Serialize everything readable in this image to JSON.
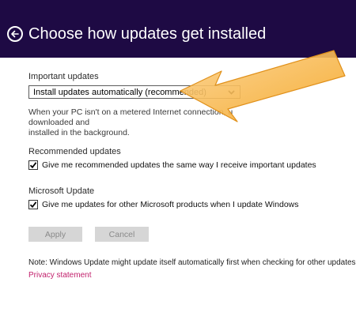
{
  "header": {
    "title": "Choose how updates get installed",
    "background": "#1e0a44",
    "back_icon": "back-arrow-circle-icon"
  },
  "important_updates": {
    "label": "Important updates",
    "selected_option": "Install updates automatically (recommended)",
    "description": "When your PC isn't on a metered Internet connection, updates will be downloaded and installed in the background.",
    "description_visible_line1_start": "When your PC isn't on a metered Internet connection, u",
    "description_visible_line1_end": "downloaded and",
    "description_line2": "installed in the background."
  },
  "recommended_updates": {
    "label": "Recommended updates",
    "checkbox_label": "Give me recommended updates the same way I receive important updates",
    "checked": true
  },
  "microsoft_update": {
    "label": "Microsoft Update",
    "checkbox_label": "Give me updates for other Microsoft products when I update Windows",
    "checked": true
  },
  "buttons": {
    "apply": "Apply",
    "cancel": "Cancel"
  },
  "footer": {
    "note": "Note: Windows Update might update itself automatically first when checking for other updates.",
    "privacy_link": "Privacy statement",
    "link_color": "#c11f6b"
  },
  "annotation": {
    "arrow_color": "#f5a623"
  }
}
